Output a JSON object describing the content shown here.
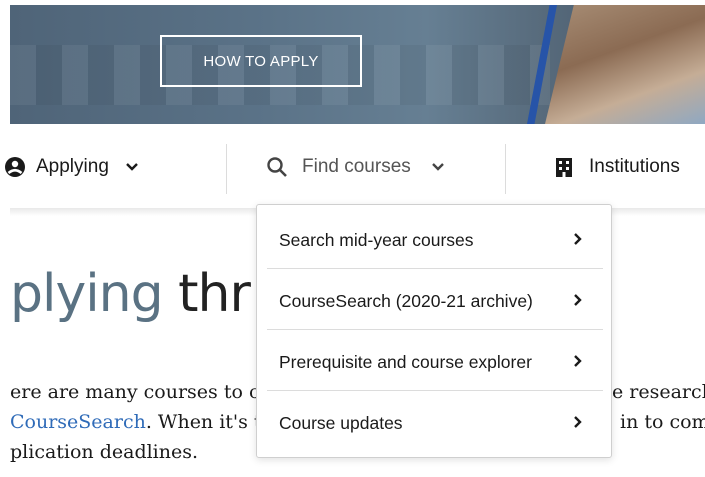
{
  "hero": {
    "button_label": "HOW TO APPLY"
  },
  "nav": {
    "items": [
      {
        "label": "Applying",
        "icon": "person-icon"
      },
      {
        "label": "Find courses",
        "icon": "search-icon"
      },
      {
        "label": "Institutions",
        "icon": "building-icon"
      }
    ]
  },
  "dropdown": {
    "items": [
      {
        "label": "Search mid-year courses"
      },
      {
        "label": "CourseSearch (2020-21 archive)"
      },
      {
        "label": "Prerequisite and course explorer"
      },
      {
        "label": "Course updates"
      }
    ]
  },
  "content": {
    "heading_colored": "plying",
    "heading_dark": " thr",
    "line1_left": "ere are many courses to ch",
    "line1_right": "e research",
    "line2_link": "CourseSearch",
    "line2_left_rest": ". When it's ti",
    "line2_right": "in to comm",
    "line3": "plication deadlines."
  },
  "colors": {
    "link": "#2f6bb8",
    "heading_accent": "#5a7283",
    "hero_stripe": "#2754a8"
  }
}
